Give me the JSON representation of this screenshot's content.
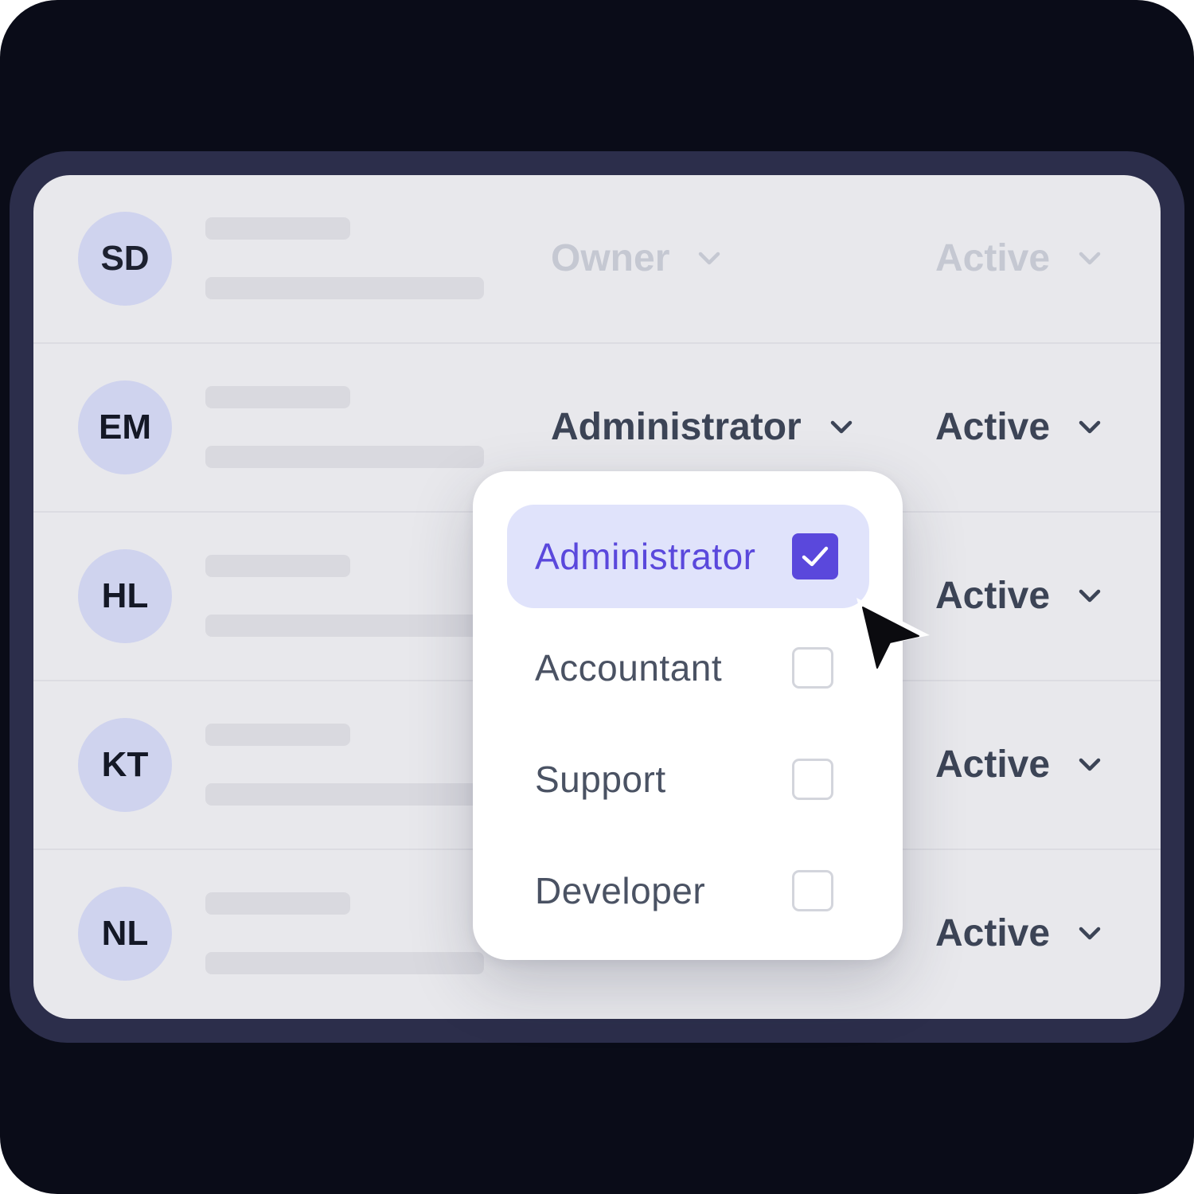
{
  "colors": {
    "background": "#0a0c18",
    "frame": "#2c2e4b",
    "panel": "#e8e8ec",
    "avatar": "#cfd3ee",
    "accent": "#5a48dc",
    "selected_option_bg": "#e0e3fb"
  },
  "users": [
    {
      "initials": "SD",
      "role": "Owner",
      "status": "Active"
    },
    {
      "initials": "EM",
      "role": "Administrator",
      "status": "Active"
    },
    {
      "initials": "HL",
      "role": "",
      "status": "Active"
    },
    {
      "initials": "KT",
      "role": "",
      "status": "Active"
    },
    {
      "initials": "NL",
      "role": "",
      "status": "Active"
    }
  ],
  "role_dropdown": {
    "options": [
      {
        "label": "Administrator",
        "checked": true
      },
      {
        "label": "Accountant",
        "checked": false
      },
      {
        "label": "Support",
        "checked": false
      },
      {
        "label": "Developer",
        "checked": false
      }
    ]
  },
  "icons": {
    "chevron": "chevron-down-icon",
    "check": "checkmark-icon",
    "cursor": "mouse-pointer-icon"
  }
}
